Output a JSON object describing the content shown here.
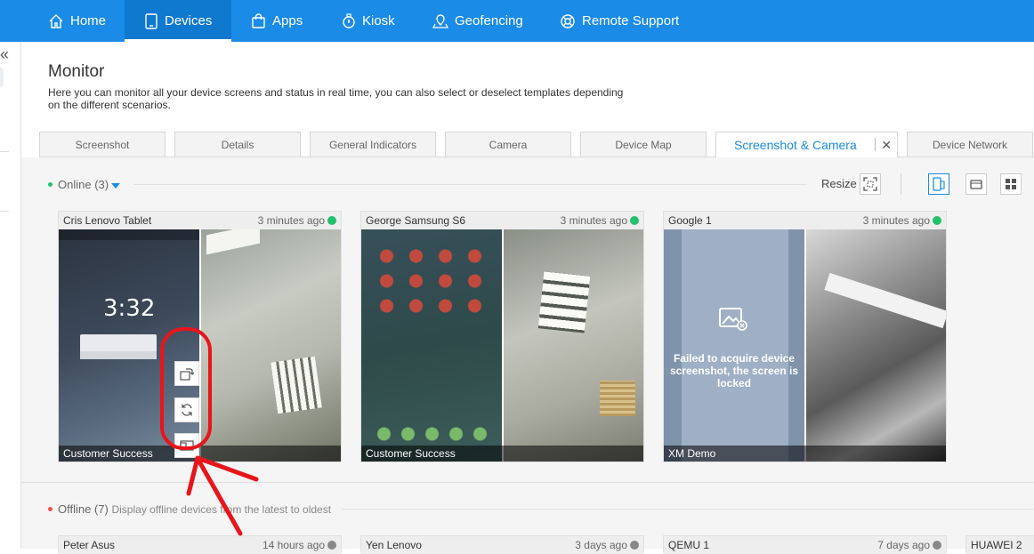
{
  "nav": {
    "items": [
      {
        "label": "Home",
        "icon": "home-icon"
      },
      {
        "label": "Devices",
        "icon": "tablet-icon",
        "active": true
      },
      {
        "label": "Apps",
        "icon": "bag-icon"
      },
      {
        "label": "Kiosk",
        "icon": "lock-icon"
      },
      {
        "label": "Geofencing",
        "icon": "map-pin-icon"
      },
      {
        "label": "Remote Support",
        "icon": "lifebuoy-icon"
      }
    ]
  },
  "page": {
    "title": "Monitor",
    "description": "Here you can monitor all your device screens and status in real time, you can also select or deselect templates depending on the different scenarios."
  },
  "tabs": [
    {
      "label": "Screenshot"
    },
    {
      "label": "Details"
    },
    {
      "label": "General Indicators"
    },
    {
      "label": "Camera"
    },
    {
      "label": "Device Map"
    },
    {
      "label": "Screenshot & Camera",
      "active": true
    },
    {
      "label": "Device Network"
    }
  ],
  "online": {
    "label": "Online (3)",
    "resize_label": "Resize",
    "devices": [
      {
        "name": "Cris Lenovo Tablet",
        "time": "3 minutes ago",
        "status": "online",
        "group": "Customer Success",
        "lock_time": "3:32"
      },
      {
        "name": "George Samsung S6",
        "time": "3 minutes ago",
        "status": "online",
        "group": "Customer Success"
      },
      {
        "name": "Google 1",
        "time": "3 minutes ago",
        "status": "online",
        "group": "XM Demo",
        "failure": "Failed to acquire device screenshot, the screen is locked"
      }
    ]
  },
  "offline": {
    "label": "Offline (7)",
    "note": "Display offline devices from the latest to oldest",
    "devices": [
      {
        "name": "Peter Asus",
        "time": "14 hours ago",
        "status": "offline"
      },
      {
        "name": "Yen Lenovo",
        "time": "3 days ago",
        "status": "offline"
      },
      {
        "name": "QEMU 1",
        "time": "7 days ago",
        "status": "offline"
      },
      {
        "name": "HUAWEI 2",
        "time": "",
        "status": "offline"
      }
    ]
  },
  "colors": {
    "brand": "#1a8be6",
    "online": "#23c16b",
    "offline": "#888888",
    "annotation": "#e8151b"
  }
}
